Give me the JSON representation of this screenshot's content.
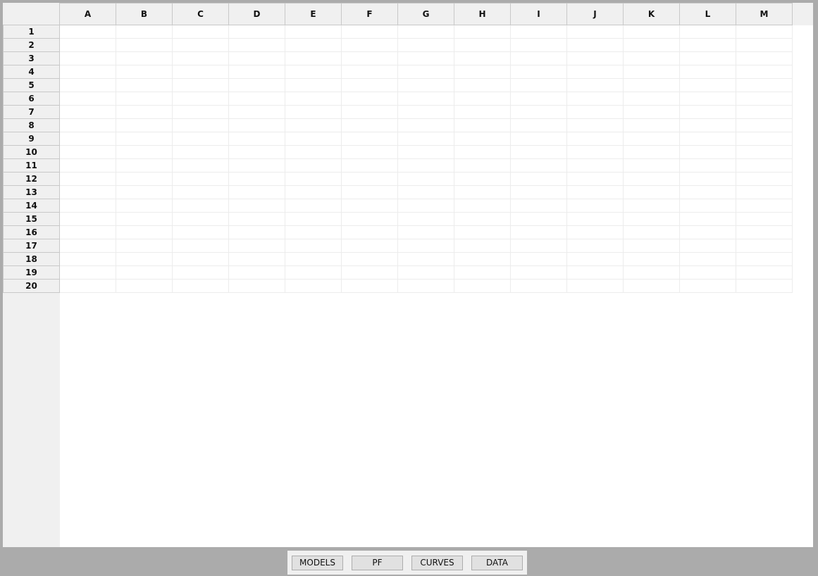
{
  "sheet": {
    "columns": [
      "A",
      "B",
      "C",
      "D",
      "E",
      "F",
      "G",
      "H",
      "I",
      "J",
      "K",
      "L",
      "M"
    ],
    "rows": [
      "1",
      "2",
      "3",
      "4",
      "5",
      "6",
      "7",
      "8",
      "9",
      "10",
      "11",
      "12",
      "13",
      "14",
      "15",
      "16",
      "17",
      "18",
      "19",
      "20"
    ]
  },
  "tabs": [
    {
      "label": "MODELS"
    },
    {
      "label": "PF"
    },
    {
      "label": "CURVES"
    },
    {
      "label": "DATA"
    }
  ],
  "colors": {
    "frame": "#ababab",
    "header": "#f0f0f0",
    "header_border": "#c8c8c8",
    "cell_border": "#ececec",
    "tab": "#e1e1e1"
  }
}
